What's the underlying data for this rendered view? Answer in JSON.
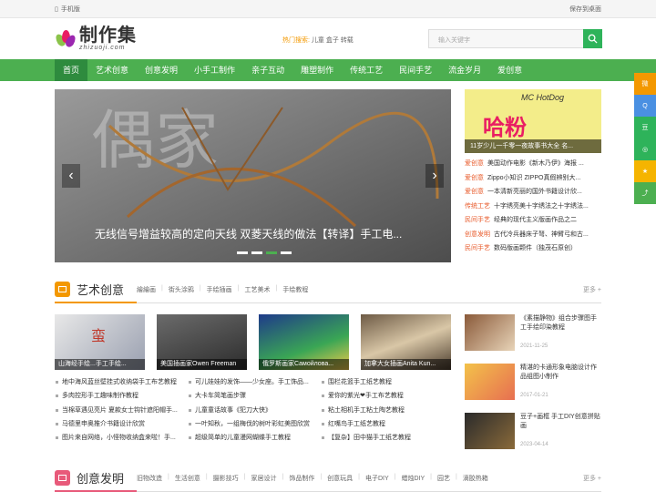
{
  "topbar": {
    "mobile": "手机版",
    "save_desktop": "保存到桌面"
  },
  "logo": {
    "cn": "制作集",
    "en": "zhizuoji.com"
  },
  "hot": {
    "label": "热门搜索:",
    "items": [
      "儿童",
      "盒子",
      "转载"
    ]
  },
  "search": {
    "placeholder": "输入关键字"
  },
  "nav": [
    "首页",
    "艺术创意",
    "创意发明",
    "小手工制作",
    "亲子互动",
    "雕塑制作",
    "传统工艺",
    "民间手艺",
    "流金岁月",
    "爱创意"
  ],
  "slider": {
    "caption": "无线信号增益较高的定向天线 双菱天线的做法【转译】手工电..."
  },
  "feature": {
    "caption": "11岁少儿一千零一夜故事书大全 名...",
    "img_text": "MC HotDog"
  },
  "side_list": [
    {
      "tag": "爱创意",
      "text": "美国动作电影《新木乃伊》海报 ..."
    },
    {
      "tag": "爱创意",
      "text": "Zippo小知识 ZIPPO真假辨别大..."
    },
    {
      "tag": "爱创意",
      "text": "一本清新亮丽的国外书籍设计欣..."
    },
    {
      "tag": "传统工艺",
      "text": "十字绣亮美十字绣法之十字绣法..."
    },
    {
      "tag": "民间手艺",
      "text": "经典的现代主义版画作品之二"
    },
    {
      "tag": "创意发明",
      "text": "古代冷兵器床子弩、神臂弓和古..."
    },
    {
      "tag": "民间手艺",
      "text": "数码版画颗件（独茂石原创）"
    }
  ],
  "sec1": {
    "title": "艺术创意",
    "tags": [
      "繪繪画",
      "街头涂鸦",
      "手绘插画",
      "工艺美术",
      "手绘教程"
    ],
    "more": "更多 +"
  },
  "thumbs": [
    "山海经手绘...手工手绘...",
    "美国插画家Owen Freeman",
    "俄罗斯画家Самойлова...",
    "加拿大女插画Anita Kun..."
  ],
  "list_cols": [
    [
      "地中海风蓝丝壁挂式收纳袋手工布艺教程",
      "多肉控形手工趣味制作教程",
      "当棉草遇见亮片 夏款女士钩针遮阳帽手...",
      "马德里申奥推介书籍设计欣赏",
      "图片来自网络，小怪物收纳盒来啦！手..."
    ],
    [
      "可儿娃娃的发饰——少女座。手工饰品...",
      "大卡车简笔画步骤",
      "儿童童话故事《犯刀大侠》",
      "一叶知秋，一组梅伐的树叶彩虹美图欣赏",
      "超级简单的儿童漫网蝴蝶手工教程"
    ],
    [
      "围栏花篮手工纸艺教程",
      "爱你的紫光❤手工布艺教程",
      "粘土相机手工粘土陶艺教程",
      "红嘴鸟手工纸艺教程",
      "【复杂】田中猫手工纸艺教程"
    ]
  ],
  "right_list": [
    {
      "title": "《素描静物》组合步骤图手工手绘印染教程",
      "date": "2021-11-25"
    },
    {
      "title": "精湛的卡通形象电脑设计作品组图小制作",
      "date": "2017-01-21"
    },
    {
      "title": "豆子+画框 手工DIY创意拼贴画",
      "date": "2023-04-14"
    }
  ],
  "sec2": {
    "title": "创意发明",
    "tags": [
      "旧物改造",
      "生活创意",
      "摄影技巧",
      "家居设计",
      "饰品制作",
      "创意玩具",
      "电子DIY",
      "蜡烛DIY",
      "园艺",
      "滴胶热箱"
    ],
    "more": "更多 +"
  },
  "colors": {
    "green": "#4caf50",
    "dark_green": "#2e8b3e",
    "orange": "#f39800",
    "pink": "#e85a7a"
  }
}
